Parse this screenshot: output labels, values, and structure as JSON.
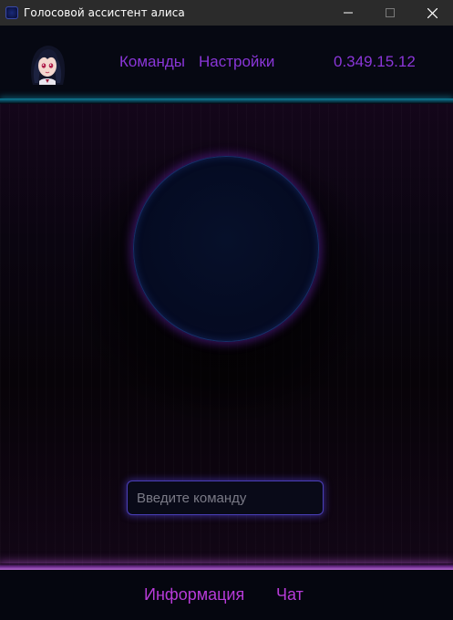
{
  "window": {
    "title": "Голосовой ассистент алиса",
    "minimize_symbol": "—",
    "maximize_symbol": "☐",
    "close_symbol": "✕"
  },
  "header": {
    "avatar_icon": "anime-girl-avatar-icon",
    "nav": {
      "commands_label": "Команды",
      "settings_label": "Настройки"
    },
    "version": "0.349.15.12"
  },
  "main": {
    "orb_icon": "voice-orb",
    "command_input": {
      "value": "",
      "placeholder": "Введите команду"
    }
  },
  "footer": {
    "info_label": "Информация",
    "chat_label": "Чат"
  },
  "colors": {
    "nav_purple": "#8a36d8",
    "footer_magenta": "#b73bd8",
    "header_glow_cyan": "#0e7f9a",
    "input_border": "#4a3fb8",
    "orb_border": "#16306a"
  }
}
